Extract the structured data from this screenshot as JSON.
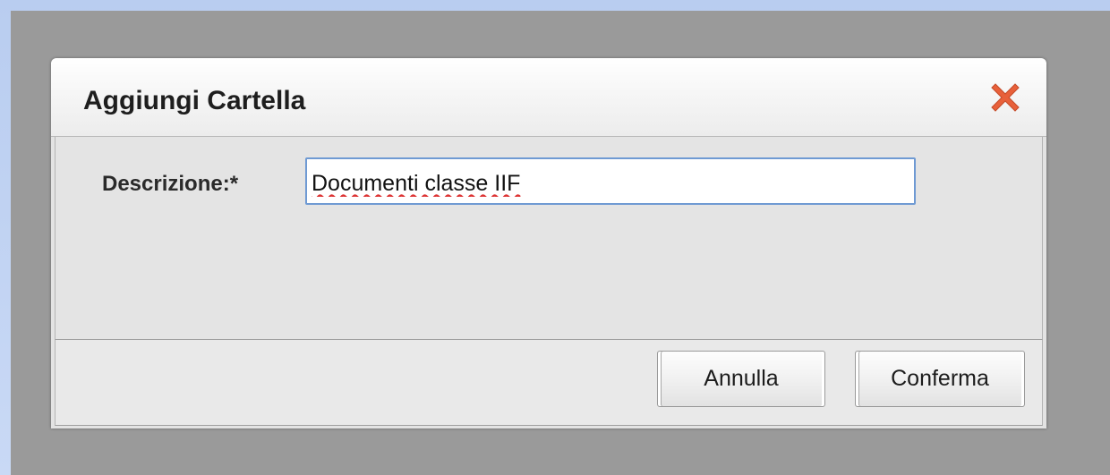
{
  "dialog": {
    "title": "Aggiungi Cartella",
    "close_icon": "close-x-icon",
    "close_color": "#e8603a"
  },
  "form": {
    "descrizione_label": "Descrizione:*",
    "descrizione_value": "Documenti classe IIF"
  },
  "footer": {
    "cancel_label": "Annulla",
    "confirm_label": "Conferma"
  },
  "colors": {
    "overlay": "#9a9a9a",
    "input_border": "#6f9ad3",
    "spellcheck_underline": "#dd3333"
  }
}
